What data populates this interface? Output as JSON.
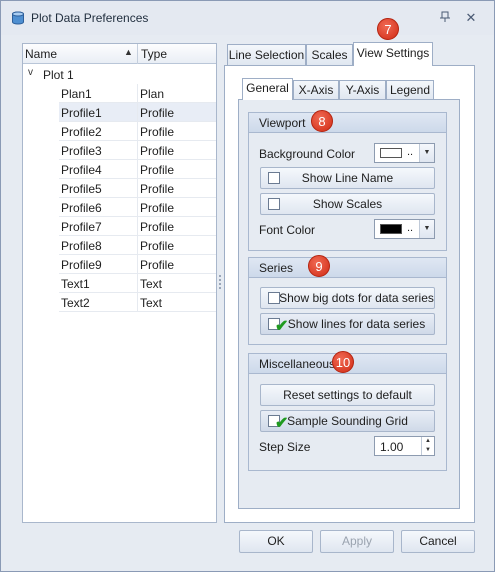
{
  "window": {
    "title": "Plot Data Preferences"
  },
  "tree": {
    "columns": {
      "name": "Name",
      "type": "Type"
    },
    "root": "Plot 1",
    "rows": [
      {
        "name": "Plan1",
        "type": "Plan"
      },
      {
        "name": "Profile1",
        "type": "Profile"
      },
      {
        "name": "Profile2",
        "type": "Profile"
      },
      {
        "name": "Profile3",
        "type": "Profile"
      },
      {
        "name": "Profile4",
        "type": "Profile"
      },
      {
        "name": "Profile5",
        "type": "Profile"
      },
      {
        "name": "Profile6",
        "type": "Profile"
      },
      {
        "name": "Profile7",
        "type": "Profile"
      },
      {
        "name": "Profile8",
        "type": "Profile"
      },
      {
        "name": "Profile9",
        "type": "Profile"
      },
      {
        "name": "Text1",
        "type": "Text"
      },
      {
        "name": "Text2",
        "type": "Text"
      }
    ],
    "selected_row": "Profile1"
  },
  "tabs": [
    "Line Selection",
    "Scales",
    "View Settings"
  ],
  "active_tab": "View Settings",
  "subtabs": [
    "General",
    "X-Axis",
    "Y-Axis",
    "Legend"
  ],
  "active_subtab": "General",
  "badges": {
    "tabs": "7",
    "viewport": "8",
    "series": "9",
    "misc": "10"
  },
  "viewport": {
    "title": "Viewport",
    "background_color_label": "Background Color",
    "background_color": "#ffffff",
    "show_line_name": "Show Line Name",
    "show_line_name_checked": false,
    "show_scales": "Show Scales",
    "show_scales_checked": false,
    "font_color_label": "Font Color",
    "font_color": "#000000",
    "color_ellipsis": ".."
  },
  "series": {
    "title": "Series",
    "big_dots": "Show big dots for data series",
    "big_dots_checked": false,
    "lines": "Show lines for data series",
    "lines_checked": true
  },
  "misc": {
    "title": "Miscellaneous",
    "reset": "Reset settings to default",
    "sample_grid": "Sample Sounding Grid",
    "sample_grid_checked": true,
    "step_size_label": "Step Size",
    "step_size": "1.00"
  },
  "buttons": {
    "ok": "OK",
    "apply": "Apply",
    "cancel": "Cancel"
  }
}
